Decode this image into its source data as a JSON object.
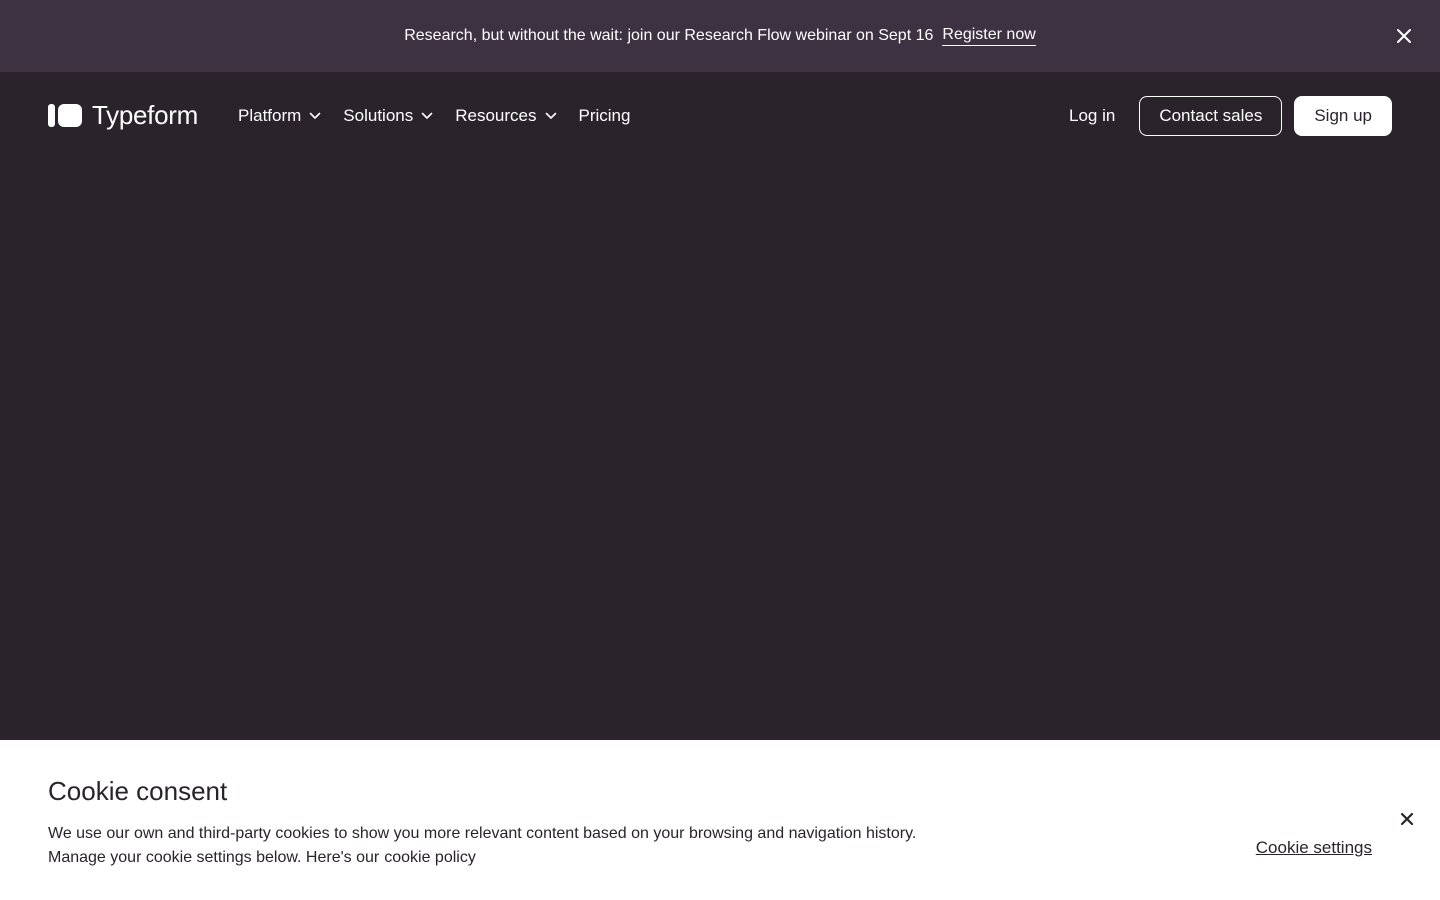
{
  "announcement": {
    "message": "Research, but without the wait: join our Research Flow webinar on Sept 16",
    "link_label": "Register now",
    "close_icon": "close-icon"
  },
  "nav": {
    "logo_text": "Typeform",
    "menu": [
      {
        "label": "Platform",
        "icon": "chevron-down-icon"
      },
      {
        "label": "Solutions",
        "icon": "chevron-down-icon"
      },
      {
        "label": "Resources",
        "icon": "chevron-down-icon"
      },
      {
        "label": "Pricing"
      }
    ],
    "login_label": "Log in",
    "contact_label": "Contact sales",
    "signup_label": "Sign up"
  },
  "cookie": {
    "title": "Cookie consent",
    "line1": "We use our own and third-party cookies to show you more relevant content based on your browsing and navigation history.",
    "line2": "Manage your cookie settings below. Here's our",
    "policy_link": "cookie policy",
    "settings_label": "Cookie settings",
    "close_icon": "close-icon"
  },
  "colors": {
    "announcement_bg": "#3d3242",
    "page_bg": "#2a232b",
    "cookie_bg": "#ffffff",
    "text_light": "#ffffff",
    "text_dark": "#2a232b"
  }
}
